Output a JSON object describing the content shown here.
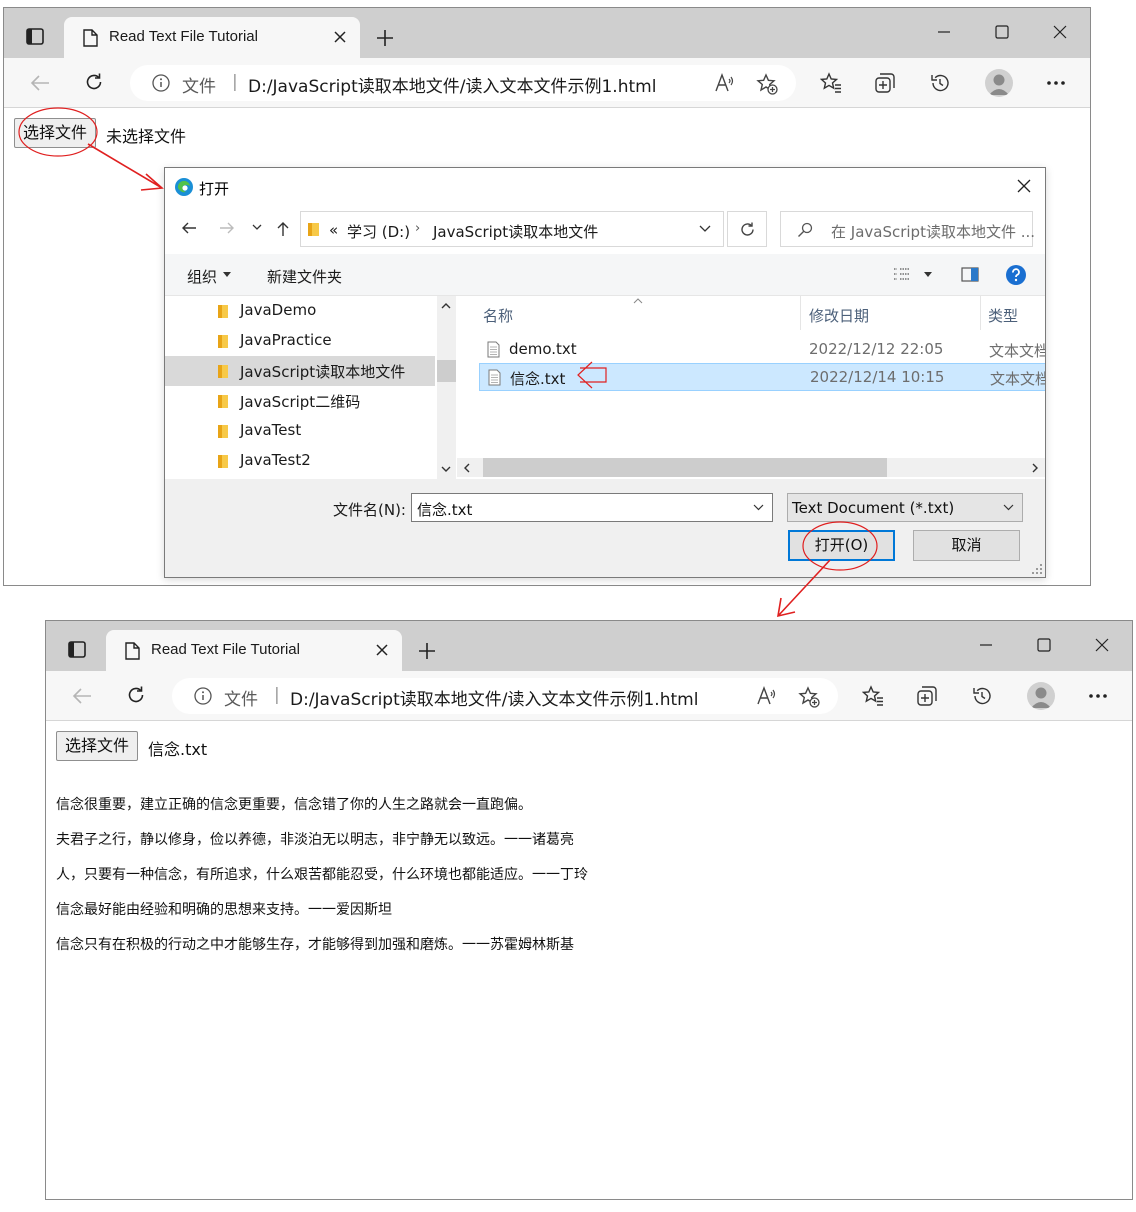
{
  "colors": {
    "tabbar": "#cfcfcf",
    "toolbar": "#f7f7f7",
    "selection": "#cce8ff",
    "accent": "#0078d7",
    "annotation": "#e02020"
  },
  "browser_before": {
    "tab_title": "Read Text File Tutorial",
    "address": {
      "label": "文件",
      "separator": "|",
      "url": "D:/JavaScript读取本地文件/读入文本文件示例1.html"
    },
    "content": {
      "file_button": "选择文件",
      "file_status": "未选择文件"
    }
  },
  "browser_after": {
    "tab_title": "Read Text File Tutorial",
    "address": {
      "label": "文件",
      "separator": "|",
      "url": "D:/JavaScript读取本地文件/读入文本文件示例1.html"
    },
    "content": {
      "file_button": "选择文件",
      "file_status": "信念.txt",
      "text_lines": [
        "信念很重要，建立正确的信念更重要，信念错了你的人生之路就会一直跑偏。",
        "夫君子之行，静以修身，俭以养德，非淡泊无以明志，非宁静无以致远。一一诸葛亮",
        "人，只要有一种信念，有所追求，什么艰苦都能忍受，什么环境也都能适应。一一丁玲",
        "信念最好能由经验和明确的思想来支持。一一爱因斯坦",
        "信念只有在积极的行动之中才能够生存，才能够得到加强和磨炼。一一苏霍姆林斯基"
      ]
    }
  },
  "dialog": {
    "title": "打开",
    "path": {
      "prefix": "«",
      "crumbs": [
        "学习 (D:)",
        "JavaScript读取本地文件"
      ]
    },
    "search_placeholder": "在 JavaScript读取本地文件 ...",
    "toolbar": {
      "organize": "组织",
      "new_folder": "新建文件夹"
    },
    "tree": [
      {
        "label": "JavaDemo",
        "selected": false
      },
      {
        "label": "JavaPractice",
        "selected": false
      },
      {
        "label": "JavaScript读取本地文件",
        "selected": true
      },
      {
        "label": "JavaScript二维码",
        "selected": false
      },
      {
        "label": "JavaTest",
        "selected": false
      },
      {
        "label": "JavaTest2",
        "selected": false
      }
    ],
    "columns": {
      "name": "名称",
      "modified": "修改日期",
      "type": "类型"
    },
    "files": [
      {
        "name": "demo.txt",
        "modified": "2022/12/12 22:05",
        "type": "文本文档",
        "selected": false
      },
      {
        "name": "信念.txt",
        "modified": "2022/12/14 10:15",
        "type": "文本文档",
        "selected": true
      }
    ],
    "filename_label": "文件名(N):",
    "filename_value": "信念.txt",
    "filetype_value": "Text Document (*.txt)",
    "open_button": "打开(O)",
    "cancel_button": "取消"
  },
  "icons": [
    "tab-actions-icon",
    "page-icon",
    "close-icon",
    "plus-icon",
    "minimize-icon",
    "maximize-icon",
    "back-arrow-icon",
    "refresh-icon",
    "info-icon",
    "read-aloud-icon",
    "add-favorite-icon",
    "favorites-icon",
    "collections-icon",
    "history-icon",
    "profile-avatar",
    "more-icon",
    "edge-logo-icon",
    "folder-icon",
    "document-icon",
    "search-icon",
    "help-icon"
  ]
}
